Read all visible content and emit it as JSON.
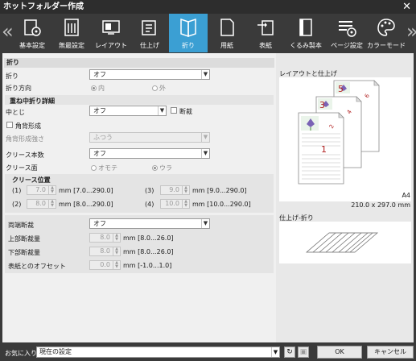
{
  "window": {
    "title": "ホットフォルダー作成",
    "close_glyph": "✕"
  },
  "toolbar": {
    "prev_glyph": "«",
    "next_glyph": "»",
    "tabs": [
      {
        "label": "基本設定",
        "icon": "basic-settings-icon"
      },
      {
        "label": "無最設定",
        "icon": "image-settings-icon"
      },
      {
        "label": "レイアウト",
        "icon": "layout-icon"
      },
      {
        "label": "仕上げ",
        "icon": "finishing-icon"
      },
      {
        "label": "折り",
        "icon": "fold-icon"
      },
      {
        "label": "用紙",
        "icon": "paper-icon"
      },
      {
        "label": "表紙",
        "icon": "cover-icon"
      },
      {
        "label": "くるみ製本",
        "icon": "perfect-bind-icon"
      },
      {
        "label": "ページ設定",
        "icon": "page-settings-icon"
      },
      {
        "label": "カラーモード",
        "icon": "color-mode-icon"
      }
    ],
    "active_tab": "折り"
  },
  "fold": {
    "section_title": "折り",
    "fold_label": "折り",
    "fold_value": "オフ",
    "direction_label": "折り方向",
    "direction_in": "内",
    "direction_out": "外"
  },
  "saddle": {
    "group_title": "重ね中折り詳細",
    "stitch_label": "中とじ",
    "stitch_value": "オフ",
    "trim_label": "断裁",
    "spine_label": "角背形成",
    "spine_strength_label": "角背形成強さ",
    "spine_strength_value": "ふつう",
    "crease_count_label": "クリース本数",
    "crease_count_value": "オフ",
    "crease_side_label": "クリース面",
    "crease_side_front": "オモテ",
    "crease_side_back": "ウラ"
  },
  "crease_pos": {
    "title": "クリース位置",
    "items": [
      {
        "idx": "(1)",
        "value": "7.0",
        "range": "mm [7.0...290.0]"
      },
      {
        "idx": "(2)",
        "value": "8.0",
        "range": "mm [8.0...290.0]"
      },
      {
        "idx": "(3)",
        "value": "9.0",
        "range": "mm [9.0...290.0]"
      },
      {
        "idx": "(4)",
        "value": "10.0",
        "range": "mm [10.0...290.0]"
      }
    ]
  },
  "trim": {
    "both_label": "両端断裁",
    "both_value": "オフ",
    "top_label": "上部断裁量",
    "top_value": "8.0",
    "top_range": "mm [8.0...26.0]",
    "bottom_label": "下部断裁量",
    "bottom_value": "8.0",
    "bottom_range": "mm [8.0...26.0]",
    "offset_label": "表紙とのオフセット",
    "offset_value": "0.0",
    "offset_range": "mm [-1.0...1.0]"
  },
  "preview": {
    "layout_title": "レイアウトと仕上げ",
    "page_numbers": [
      "1",
      "2",
      "3",
      "4",
      "5",
      "6"
    ],
    "paper_size": "A4",
    "paper_dims": "210.0 x 297.0 mm",
    "finish_title": "仕上げ-折り"
  },
  "bottom": {
    "favorites_label": "お気に入り",
    "favorites_value": "現在の設定",
    "ok_label": "OK",
    "cancel_label": "キャンセル"
  }
}
